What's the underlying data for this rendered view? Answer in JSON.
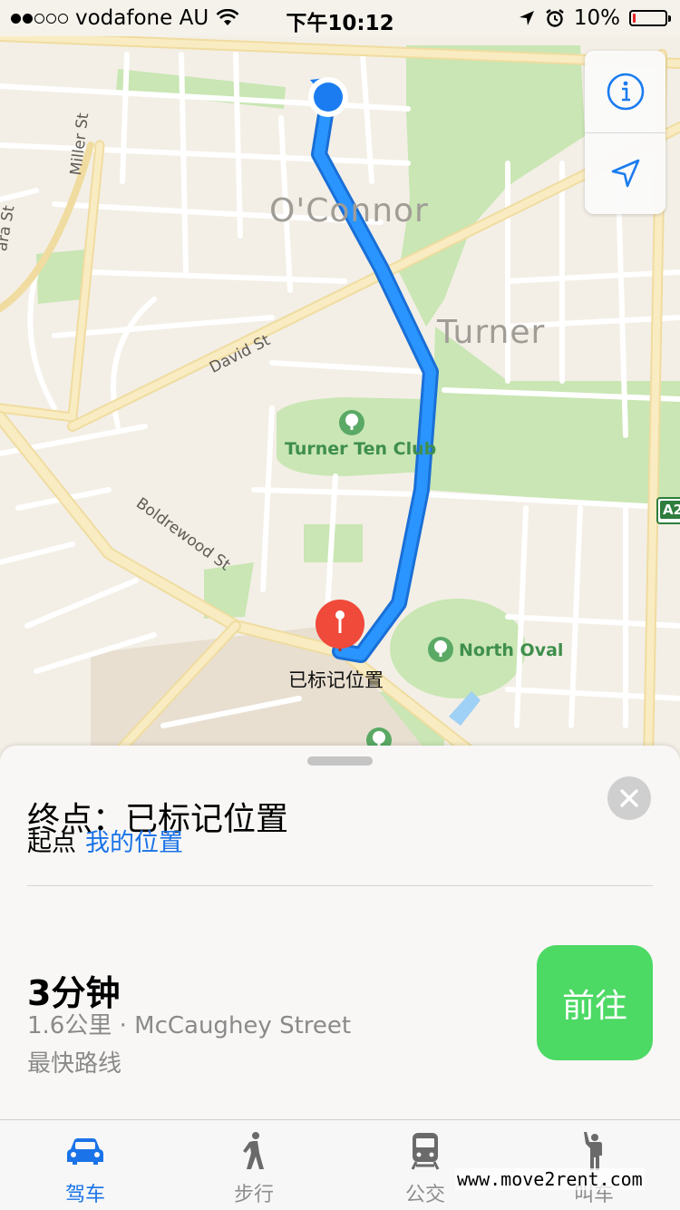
{
  "status_bar": {
    "carrier": "vodafone AU",
    "time": "下午10:12",
    "battery_percent": "10%",
    "battery_level": 0.1,
    "signal_bars": 2,
    "icons": [
      "wifi-icon",
      "location-arrow-icon",
      "alarm-icon"
    ]
  },
  "map": {
    "suburbs": [
      "O'Connor",
      "Turner"
    ],
    "streets": [
      "Miller St",
      "David St",
      "Boldrewood St",
      "ara St"
    ],
    "places": [
      "Turner Ten Club",
      "North Oval"
    ],
    "pin_label": "已标记位置",
    "highway_shield": "A2",
    "controls": {
      "info_icon": "info-icon",
      "locate_icon": "location-arrow-icon"
    },
    "colors": {
      "route": "#1e90f5",
      "park": "#c9e6b4",
      "road_major": "#f7e9b4",
      "pin": "#f04a3b",
      "user_location": "#1a7cf0"
    }
  },
  "card": {
    "destination": "终点：已标记位置",
    "origin_label": "起点",
    "origin_value": "我的位置",
    "close_icon": "close-icon",
    "route_time": "3分钟",
    "route_detail": "1.6公里 · McCaughey Street",
    "route_note": "最快路线",
    "go_label": "前往",
    "go_color": "#4cd964"
  },
  "tabs": [
    {
      "label": "驾车",
      "icon": "car-icon",
      "active": true
    },
    {
      "label": "步行",
      "icon": "walking-icon",
      "active": false
    },
    {
      "label": "公交",
      "icon": "train-icon",
      "active": false
    },
    {
      "label": "叫车",
      "icon": "hail-ride-icon",
      "active": false
    }
  ],
  "watermark": "www.move2rent.com"
}
